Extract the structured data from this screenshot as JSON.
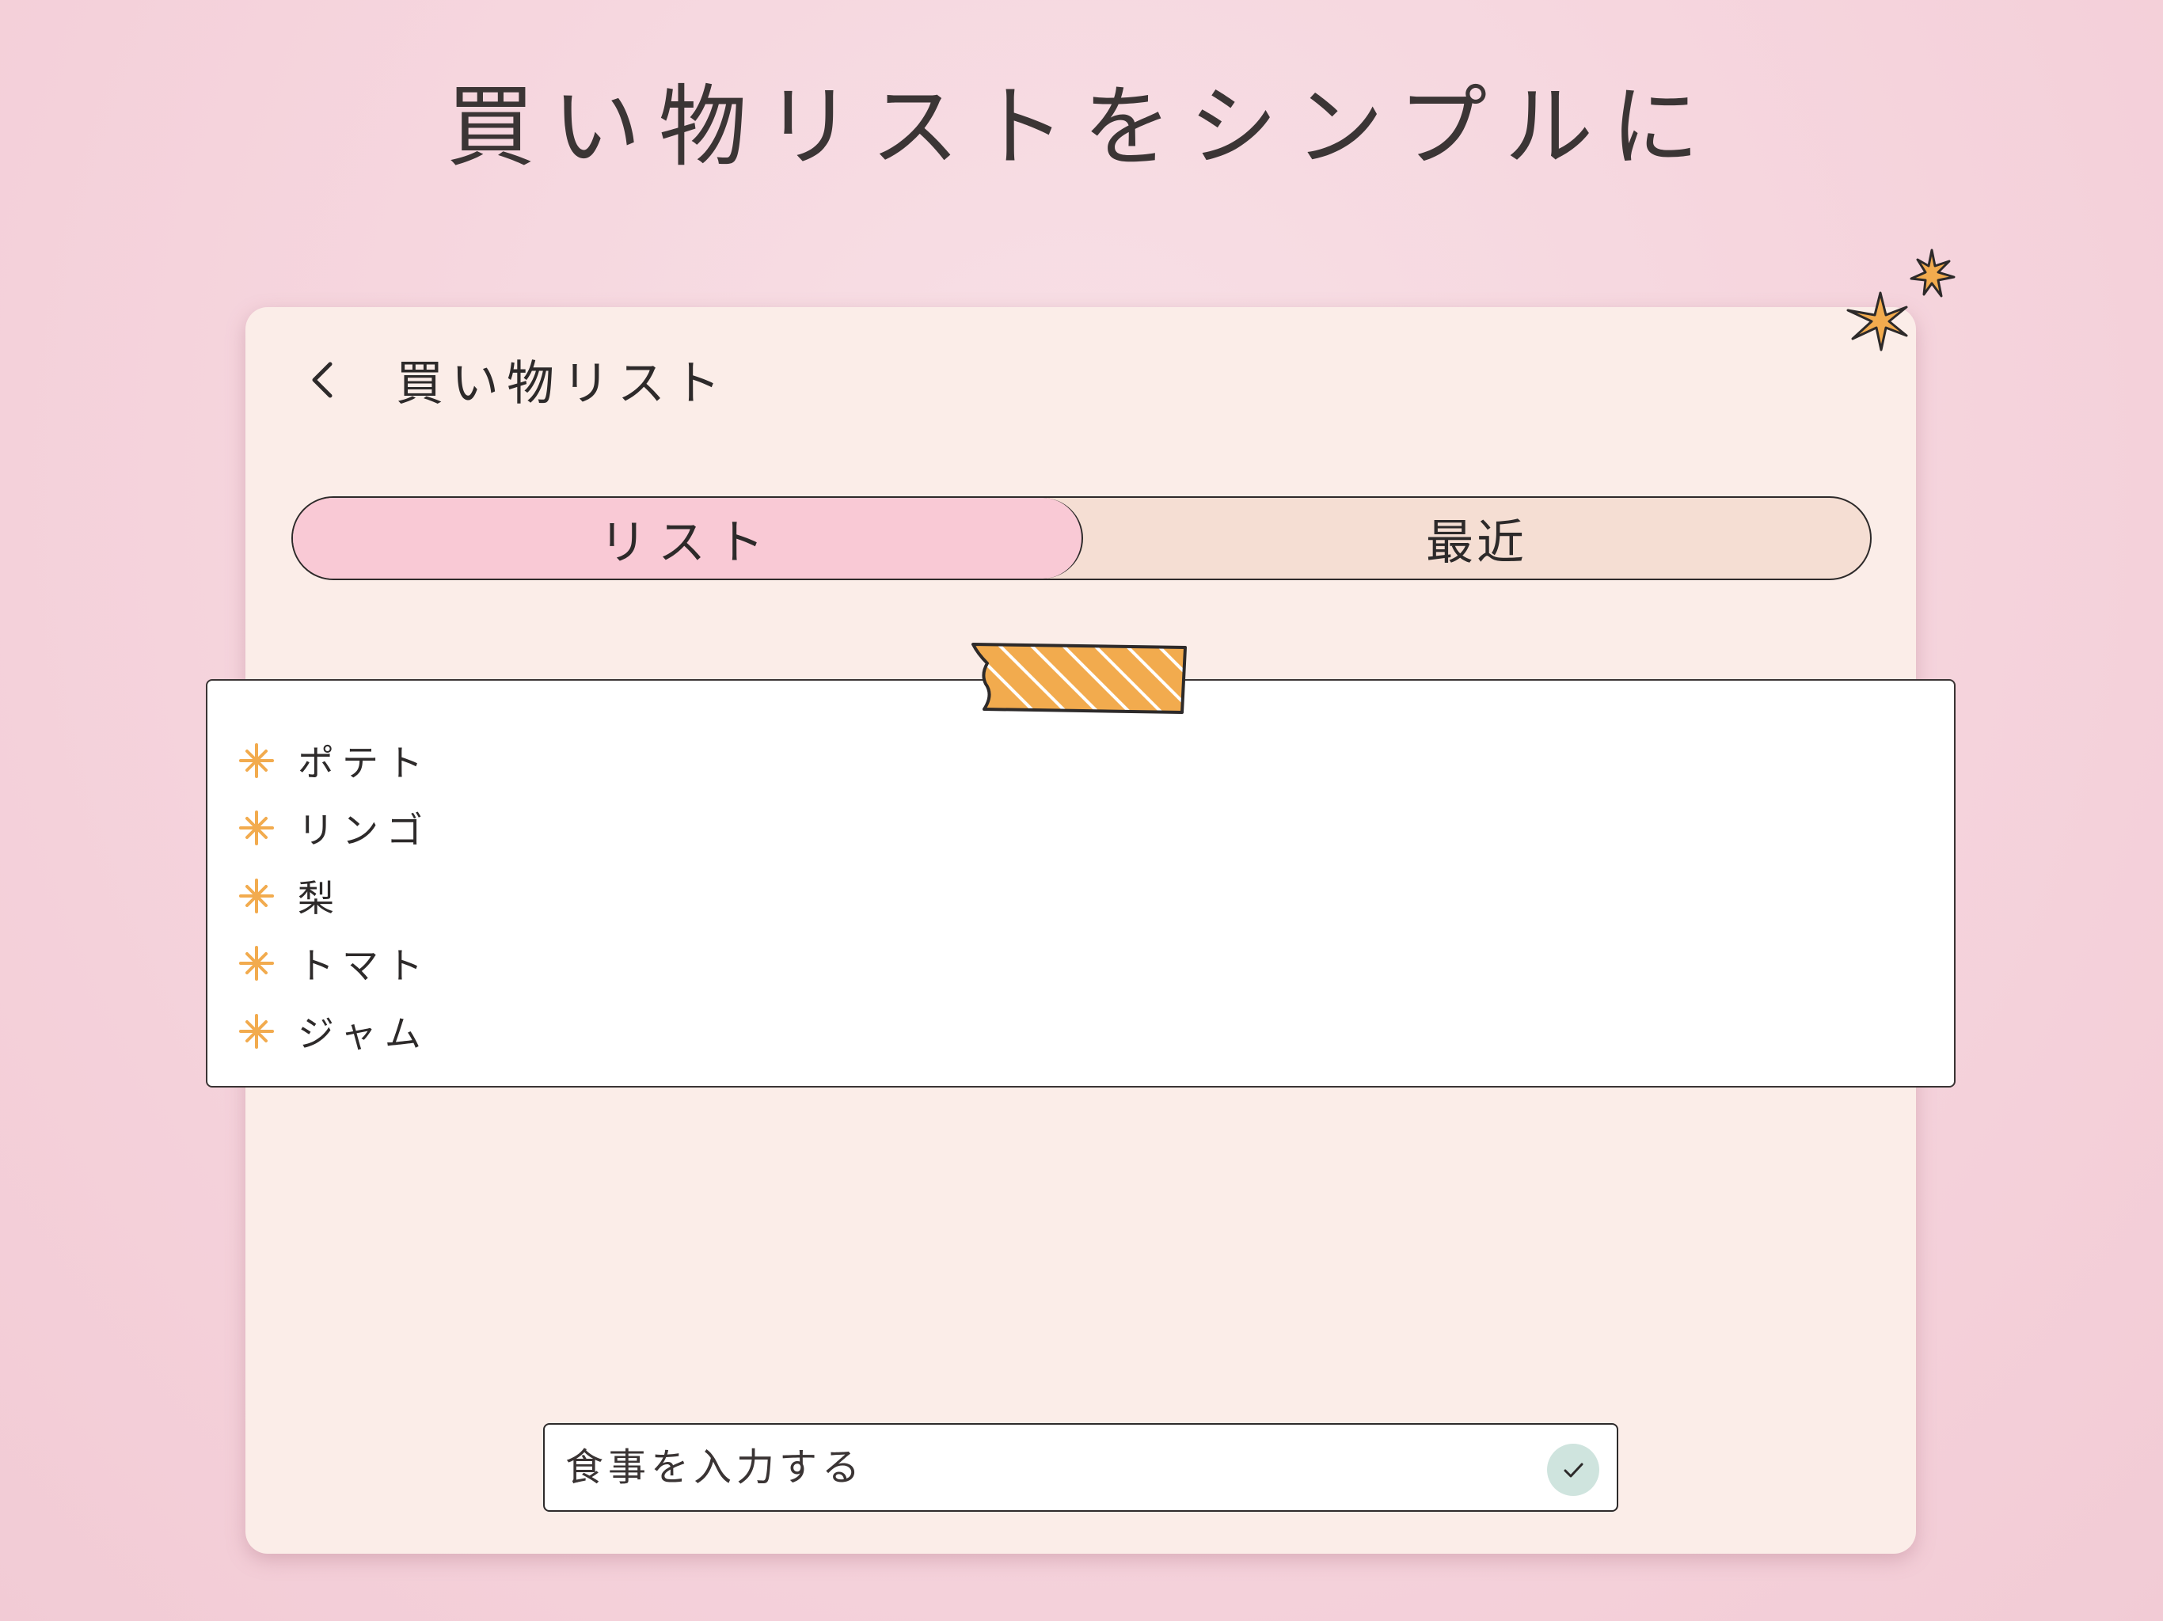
{
  "headline": "買い物リストをシンプルに",
  "header": {
    "back_icon": "chevron-left-icon",
    "title": "買い物リスト"
  },
  "tabs": [
    {
      "label": "リスト",
      "active": true
    },
    {
      "label": "最近",
      "active": false
    }
  ],
  "list": {
    "bullet_icon": "sparkle-icon",
    "items": [
      {
        "label": "ポテト"
      },
      {
        "label": "リンゴ"
      },
      {
        "label": "梨"
      },
      {
        "label": "トマト"
      },
      {
        "label": "ジャム"
      }
    ]
  },
  "input": {
    "value": "",
    "placeholder": "食事を入力する",
    "submit_icon": "check-icon"
  },
  "colors": {
    "background": "#f5d3dc",
    "card": "#fbede8",
    "active_tab": "#f9c9d5",
    "inactive_tab": "#f5ded3",
    "accent_orange": "#f2ab4e",
    "submit_button": "#cfe4de",
    "text": "#2d2a2a"
  }
}
